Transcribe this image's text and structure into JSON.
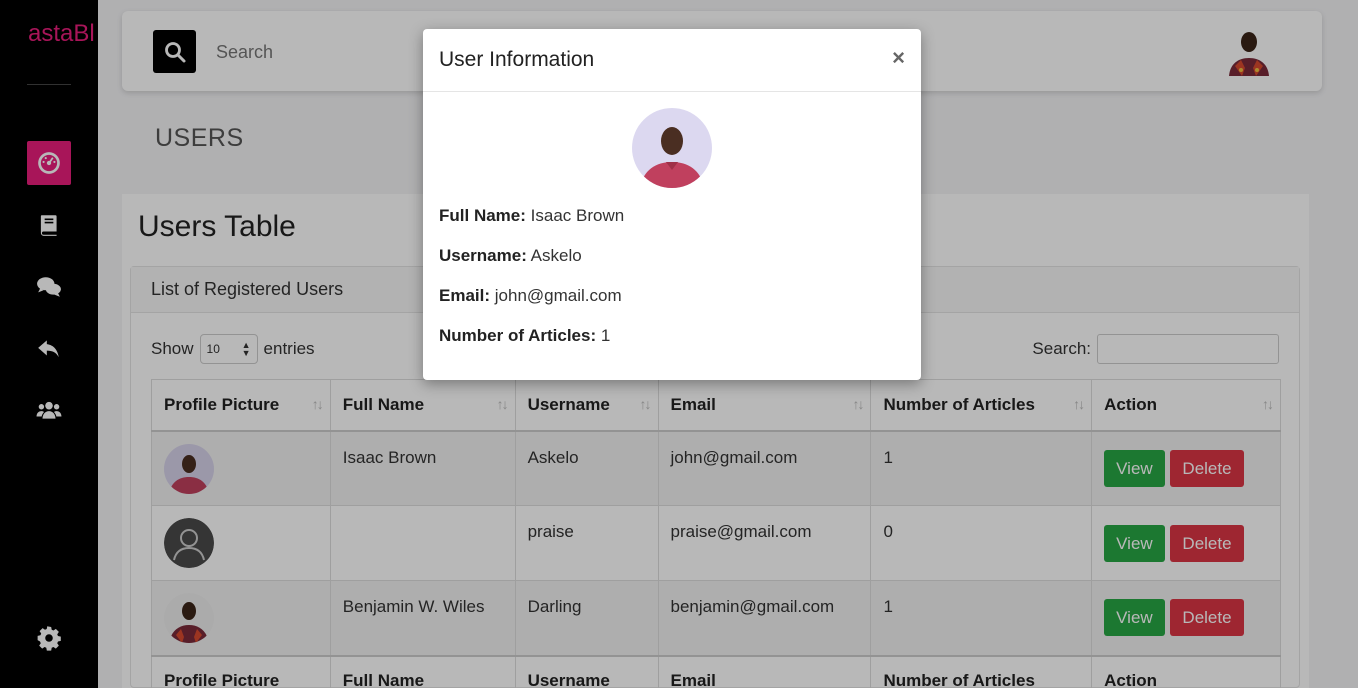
{
  "app": {
    "brand": "astaBl"
  },
  "topbar": {
    "search_placeholder": "Search"
  },
  "page": {
    "heading": "USERS",
    "card_title": "Users Table",
    "section_title": "List of Registered Users"
  },
  "table_controls": {
    "show_label": "Show",
    "entries_value": "10",
    "entries_label": "entries",
    "search_label": "Search:"
  },
  "table": {
    "columns": [
      "Profile Picture",
      "Full Name",
      "Username",
      "Email",
      "Number of Articles",
      "Action"
    ],
    "rows": [
      {
        "full_name": "Isaac Brown",
        "username": "Askelo",
        "email": "john@gmail.com",
        "articles": "1",
        "avatar": "photo-man-pink-shirt"
      },
      {
        "full_name": "",
        "username": "praise",
        "email": "praise@gmail.com",
        "articles": "0",
        "avatar": "default-user-icon"
      },
      {
        "full_name": "Benjamin W. Wiles",
        "username": "Darling",
        "email": "benjamin@gmail.com",
        "articles": "1",
        "avatar": "photo-man-patterned-shirt"
      }
    ],
    "view_label": "View",
    "delete_label": "Delete"
  },
  "modal": {
    "title": "User Information",
    "close_glyph": "×",
    "full_name_label": "Full Name:",
    "full_name": "Isaac Brown",
    "username_label": "Username:",
    "username": "Askelo",
    "email_label": "Email:",
    "email": "john@gmail.com",
    "articles_label": "Number of Articles:",
    "articles": "1"
  },
  "colors": {
    "accent": "#e91e7c",
    "view": "#28a745",
    "delete": "#dc3545"
  },
  "icons": [
    "dashboard-icon",
    "book-icon",
    "comments-icon",
    "reply-icon",
    "users-icon",
    "settings-icon",
    "search-icon",
    "sort-icon"
  ]
}
